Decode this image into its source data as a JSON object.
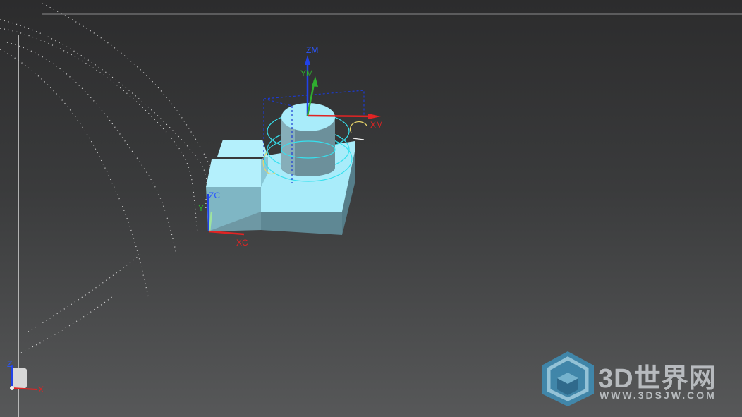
{
  "viewport": {
    "background_top": "#2c2c2d",
    "background_bottom": "#575859"
  },
  "model_csys": {
    "z_label": "ZM",
    "y_label": "YM",
    "x_label": "XM"
  },
  "work_csys": {
    "z_label": "ZC",
    "y_label": "Y",
    "x_label": "XC"
  },
  "view_triad": {
    "z_label": "Z",
    "x_label": "X"
  },
  "colors": {
    "solid_face_light": "#a9ecfa",
    "solid_face_side": "#6f96a3",
    "selection_cyan": "#36e1ef",
    "box_blue": "#1d3bd1",
    "axis_x_red": "#e02424",
    "axis_y_green": "#2fae2f",
    "axis_z_blue": "#2142e8"
  },
  "watermark": {
    "title": "3D世界网",
    "url": "WWW.3DSJW.COM",
    "logo_icon": "cube-logo-icon"
  }
}
